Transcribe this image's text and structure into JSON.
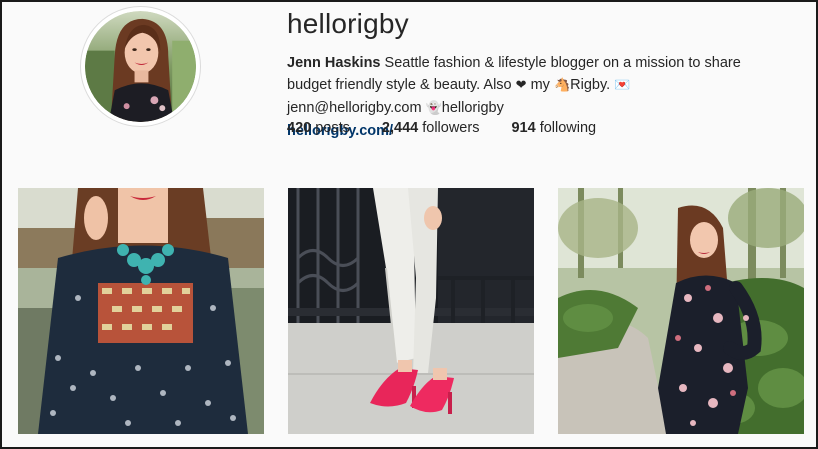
{
  "profile": {
    "username": "hellorigby",
    "full_name": "Jenn Haskins",
    "bio_part1": "Seattle fashion & lifestyle blogger on a mission to share budget friendly style & beauty. Also",
    "bio_heart": "❤",
    "bio_part2": "my",
    "bio_dog_emoji": "🐴",
    "bio_part3": "Rigby.",
    "bio_mail_emoji": "💌",
    "bio_email": "jenn@hellorigby.com",
    "bio_ghost_emoji": "👻",
    "bio_snapchat": "hellorigby",
    "website": "hellorigby.com/"
  },
  "stats": {
    "posts_count": "420",
    "posts_label": "posts",
    "followers_count": "2,444",
    "followers_label": "followers",
    "following_count": "914",
    "following_label": "following"
  },
  "colors": {
    "background": "#fafafa",
    "text": "#262626",
    "link": "#003569",
    "border": "#dbdbdb"
  },
  "posts": [
    {
      "alt": "Woman in printed peasant dress with turquoise statement necklace"
    },
    {
      "alt": "White cropped trousers with hot pink pumps"
    },
    {
      "alt": "Woman in dark floral dress in a garden"
    }
  ]
}
